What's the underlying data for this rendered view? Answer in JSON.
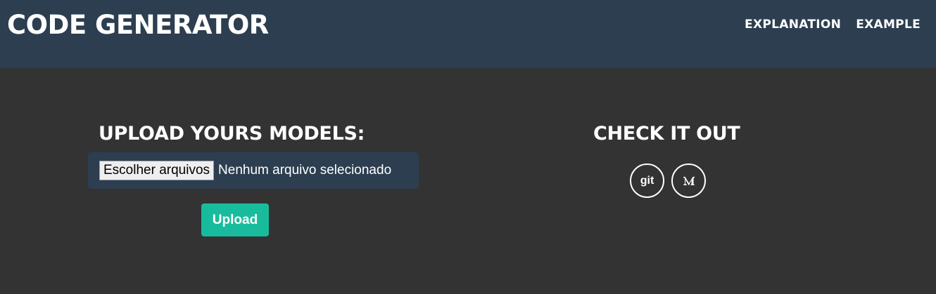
{
  "header": {
    "brand": "CODE GENERATOR",
    "nav": [
      {
        "label": "EXPLANATION"
      },
      {
        "label": "EXAMPLE"
      }
    ]
  },
  "upload": {
    "title": "UPLOAD YOURS MODELS:",
    "file_button_label": "Escolher arquivos",
    "file_status": "Nenhum arquivo selecionado",
    "upload_label": "Upload"
  },
  "check_it_out": {
    "title": "CHECK IT OUT",
    "links": [
      {
        "icon": "git-icon",
        "text": "git"
      },
      {
        "icon": "medium-icon"
      }
    ]
  },
  "colors": {
    "header_bg": "#2c3e50",
    "page_bg": "#333333",
    "accent": "#18bc9c",
    "text": "#ffffff"
  }
}
